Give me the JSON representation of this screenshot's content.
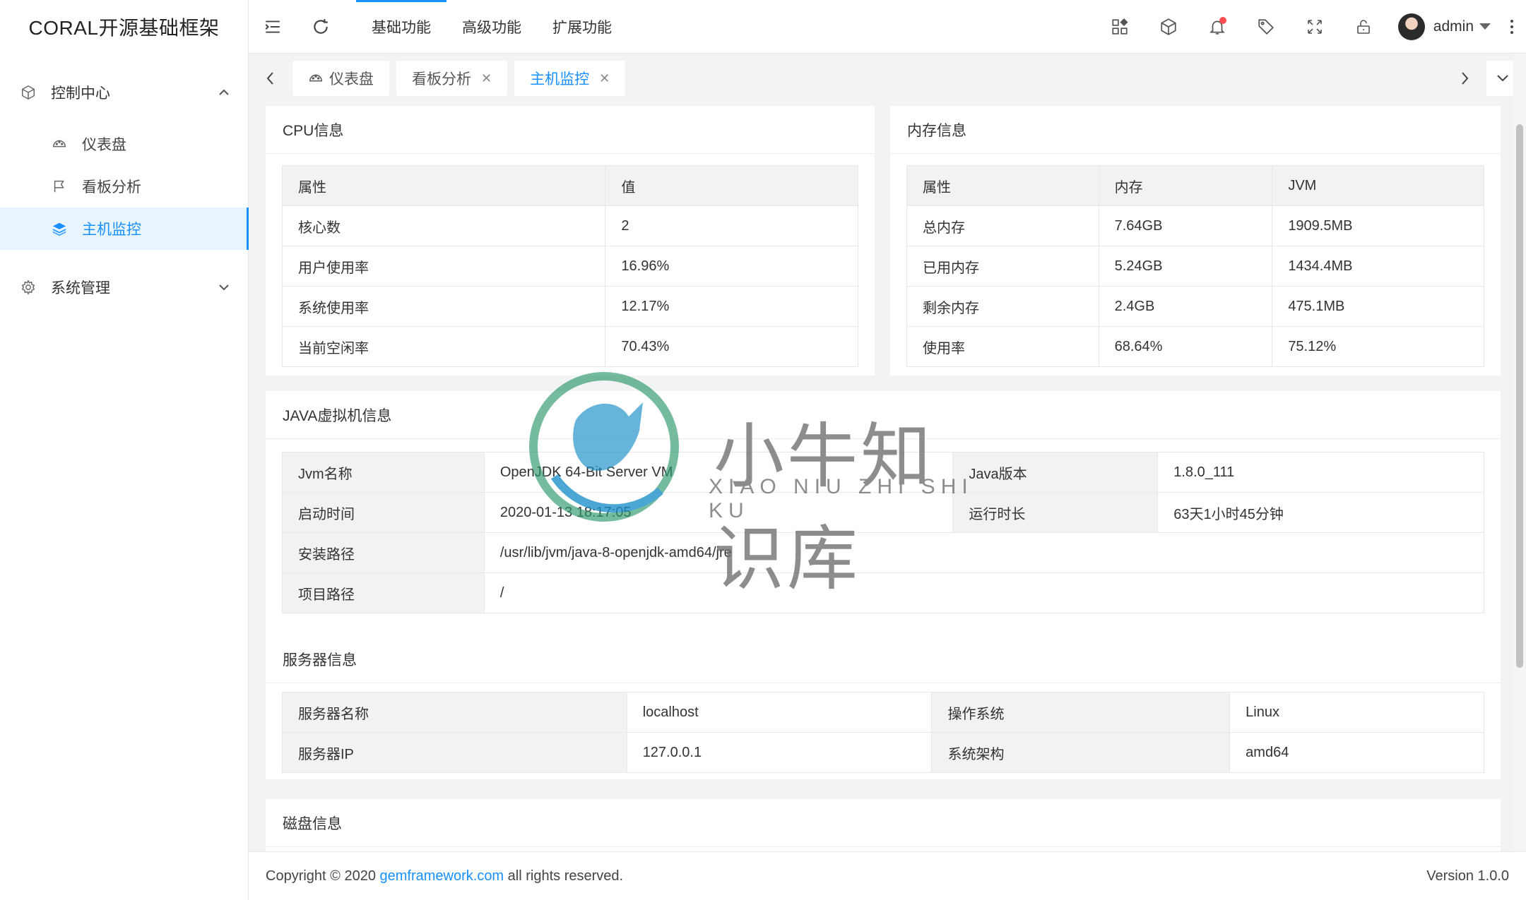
{
  "app": {
    "title": "CORAL开源基础框架"
  },
  "sidebar": {
    "groups": [
      {
        "label": "控制中心",
        "icon": "cube-icon",
        "expanded": true,
        "items": [
          {
            "label": "仪表盘",
            "icon": "dashboard-icon"
          },
          {
            "label": "看板分析",
            "icon": "flag-icon"
          },
          {
            "label": "主机监控",
            "icon": "layers-icon",
            "active": true
          }
        ]
      },
      {
        "label": "系统管理",
        "icon": "gear-icon",
        "expanded": false
      }
    ]
  },
  "header": {
    "nav": [
      "基础功能",
      "高级功能",
      "扩展功能"
    ],
    "active_nav": 0,
    "user": "admin"
  },
  "tabs": [
    {
      "label": "仪表盘",
      "icon": "dashboard-icon",
      "closable": false
    },
    {
      "label": "看板分析",
      "closable": true
    },
    {
      "label": "主机监控",
      "closable": true,
      "active": true
    }
  ],
  "cpu": {
    "title": "CPU信息",
    "headers": [
      "属性",
      "值"
    ],
    "rows": [
      [
        "核心数",
        "2"
      ],
      [
        "用户使用率",
        "16.96%"
      ],
      [
        "系统使用率",
        "12.17%"
      ],
      [
        "当前空闲率",
        "70.43%"
      ]
    ]
  },
  "memory": {
    "title": "内存信息",
    "headers": [
      "属性",
      "内存",
      "JVM"
    ],
    "rows": [
      [
        "总内存",
        "7.64GB",
        "1909.5MB"
      ],
      [
        "已用内存",
        "5.24GB",
        "1434.4MB"
      ],
      [
        "剩余内存",
        "2.4GB",
        "475.1MB"
      ],
      [
        "使用率",
        "68.64%",
        "75.12%"
      ]
    ]
  },
  "jvm": {
    "title": "JAVA虚拟机信息",
    "jvm_name_label": "Jvm名称",
    "jvm_name": "OpenJDK 64-Bit Server VM",
    "java_version_label": "Java版本",
    "java_version": "1.8.0_111",
    "start_time_label": "启动时间",
    "start_time": "2020-01-13 18:17:05",
    "uptime_label": "运行时长",
    "uptime": "63天1小时45分钟",
    "install_path_label": "安装路径",
    "install_path": "/usr/lib/jvm/java-8-openjdk-amd64/jre",
    "project_path_label": "项目路径",
    "project_path": "/"
  },
  "server": {
    "title": "服务器信息",
    "name_label": "服务器名称",
    "name": "localhost",
    "os_label": "操作系统",
    "os": "Linux",
    "ip_label": "服务器IP",
    "ip": "127.0.0.1",
    "arch_label": "系统架构",
    "arch": "amd64"
  },
  "disk": {
    "title": "磁盘信息"
  },
  "footer": {
    "copyright_prefix": "Copyright © 2020",
    "link": "gemframework.com",
    "copyright_suffix": "all rights reserved.",
    "version": "Version 1.0.0"
  },
  "watermark": {
    "cn": "小牛知识库",
    "en": "XIAO NIU ZHI SHI KU"
  },
  "colors": {
    "accent": "#1890ff",
    "badge": "#ff4d4f"
  }
}
